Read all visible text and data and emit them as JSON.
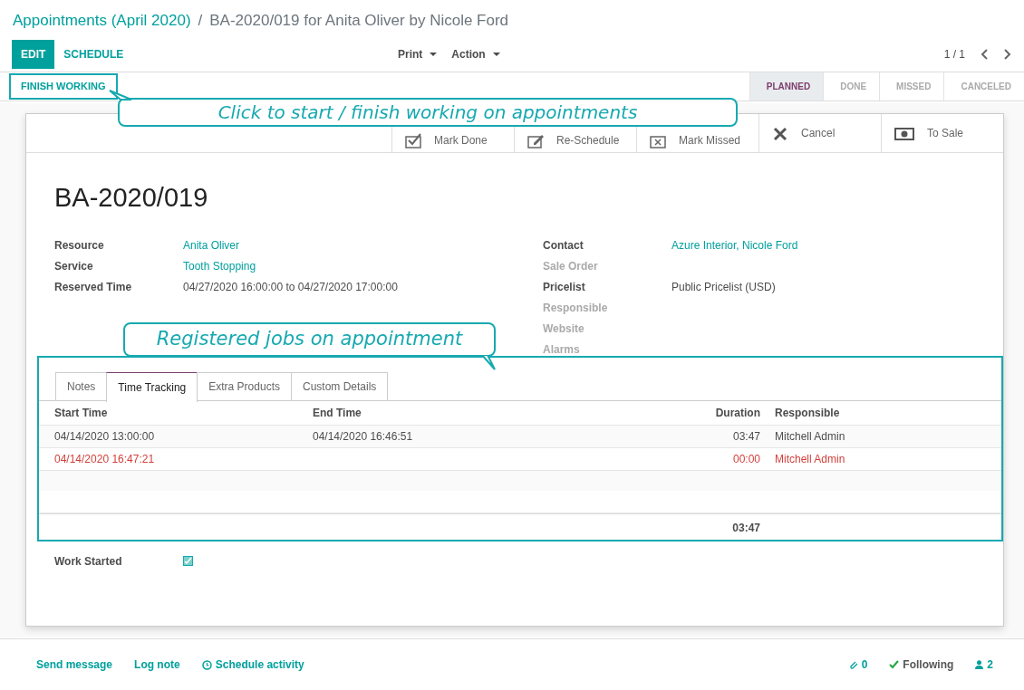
{
  "breadcrumb": {
    "parent": "Appointments (April 2020)",
    "separator": "/",
    "current": "BA-2020/019 for Anita Oliver by Nicole Ford"
  },
  "control_buttons": [
    {
      "label": "EDIT",
      "kind": "primary"
    },
    {
      "label": "SCHEDULE",
      "kind": "link"
    }
  ],
  "menus": [
    "Print",
    "Action"
  ],
  "pager": "1 / 1",
  "header_button": "FINISH WORKING",
  "stages": [
    {
      "label": "PLANNED",
      "selected": true
    },
    {
      "label": "DONE",
      "selected": false
    },
    {
      "label": "MISSED",
      "selected": false
    },
    {
      "label": "CANCELED",
      "selected": false
    }
  ],
  "smart_buttons": [
    {
      "label": "Mark Done",
      "kind": "check"
    },
    {
      "label": "Re-Schedule",
      "kind": "edit"
    },
    {
      "label": "Mark Missed",
      "kind": "cross-box"
    },
    {
      "label": "Cancel",
      "kind": "cross"
    },
    {
      "label": "To Sale",
      "kind": "money"
    }
  ],
  "title": "BA-2020/019",
  "fields_left": [
    {
      "label": "Resource",
      "value": "Anita Oliver",
      "link": true
    },
    {
      "label": "Service",
      "value": "Tooth Stopping",
      "link": true
    },
    {
      "label": "Reserved Time",
      "value": "04/27/2020 16:00:00 to 04/27/2020 17:00:00",
      "link": false
    }
  ],
  "fields_right": [
    {
      "label": "Contact",
      "value": "Azure Interior, Nicole Ford",
      "link": true
    },
    {
      "label": "Sale Order"
    },
    {
      "label": "Pricelist",
      "value": "Public Pricelist (USD)",
      "link": false
    },
    {
      "label": "Responsible"
    },
    {
      "label": "Website"
    },
    {
      "label": "Alarms"
    }
  ],
  "tabs": [
    {
      "label": "Notes",
      "selected": false
    },
    {
      "label": "Time Tracking",
      "selected": true
    },
    {
      "label": "Extra Products",
      "selected": false
    },
    {
      "label": "Custom Details",
      "selected": false
    }
  ],
  "table": {
    "columns": [
      "Start Time",
      "End Time",
      "Duration",
      "Responsible"
    ],
    "rows": [
      {
        "cells": [
          "04/14/2020 13:00:00",
          "04/14/2020 16:46:51",
          "03:47",
          "Mitchell Admin"
        ],
        "running": false
      },
      {
        "cells": [
          "04/14/2020 16:47:21",
          "",
          "00:00",
          "Mitchell Admin"
        ],
        "running": true
      }
    ],
    "total": "03:47"
  },
  "work_started": {
    "label": "Work Started",
    "checked": true
  },
  "callouts": [
    "Click to start / finish working on appointments",
    "Registered jobs on appointment"
  ],
  "chatter": {
    "send_message": "Send message",
    "log_note": "Log note",
    "schedule_activity": "Schedule activity",
    "attachments": "0",
    "following": "Following",
    "followers": "2"
  }
}
